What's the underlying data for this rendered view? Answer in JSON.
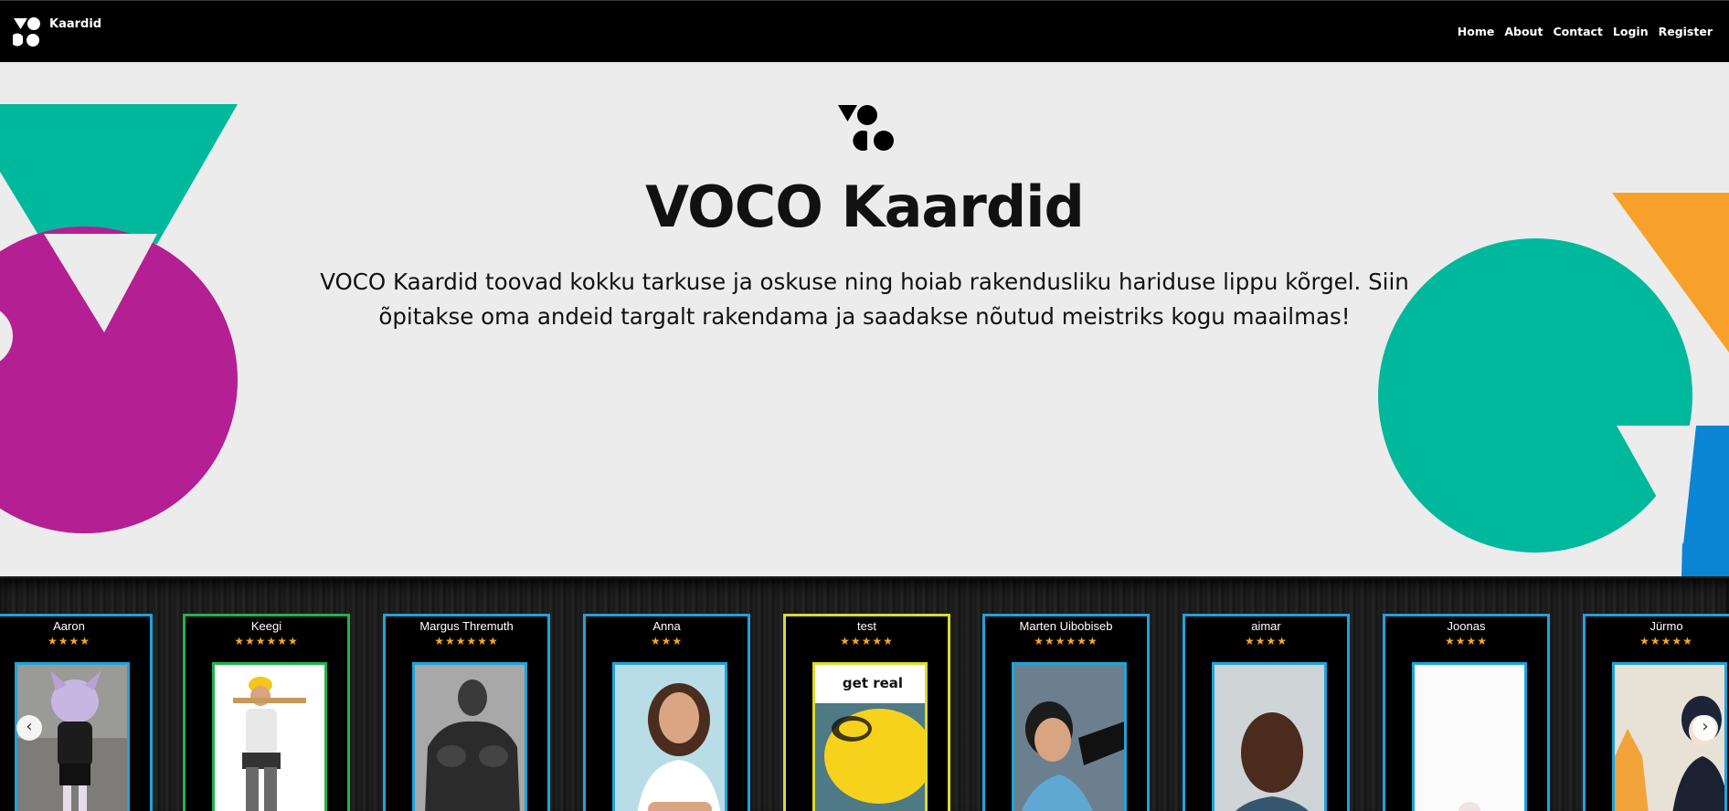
{
  "navbar": {
    "brand": "Kaardid",
    "links": [
      "Home",
      "About",
      "Contact",
      "Login",
      "Register"
    ]
  },
  "hero": {
    "title": "VOCO Kaardid",
    "text": "VOCO Kaardid toovad kokku tarkuse ja oskuse ning hoiab rakendusliku hariduse lippu kõrgel. Siin õpitakse oma andeid targalt rakendama ja saadakse nõutud meistriks kogu maailmas!"
  },
  "colors": {
    "teal": "#00b89c",
    "magenta": "#b41f93",
    "orange": "#f7a12b",
    "blue": "#0a86d4",
    "card_blue": "#1fa3d9",
    "card_green": "#22b24c",
    "card_yellow": "#d8dc2e",
    "star": "#f5a623"
  },
  "carousel": {
    "prev_icon": "chevron-left-icon",
    "next_icon": "chevron-right-icon",
    "cards": [
      {
        "name": "Aaron",
        "stars": 4,
        "frame": "blue"
      },
      {
        "name": "Keegi",
        "stars": 6,
        "frame": "green"
      },
      {
        "name": "Margus Thremuth",
        "stars": 6,
        "frame": "blue"
      },
      {
        "name": "Anna",
        "stars": 3,
        "frame": "blue"
      },
      {
        "name": "test",
        "stars": 5,
        "frame": "yellow",
        "photo_text": "get real"
      },
      {
        "name": "Marten Uibobiseb",
        "stars": 6,
        "frame": "blue"
      },
      {
        "name": "aimar",
        "stars": 4,
        "frame": "blue"
      },
      {
        "name": "Joonas",
        "stars": 4,
        "frame": "blue"
      },
      {
        "name": "Jürmo",
        "stars": 5,
        "frame": "blue"
      }
    ]
  }
}
